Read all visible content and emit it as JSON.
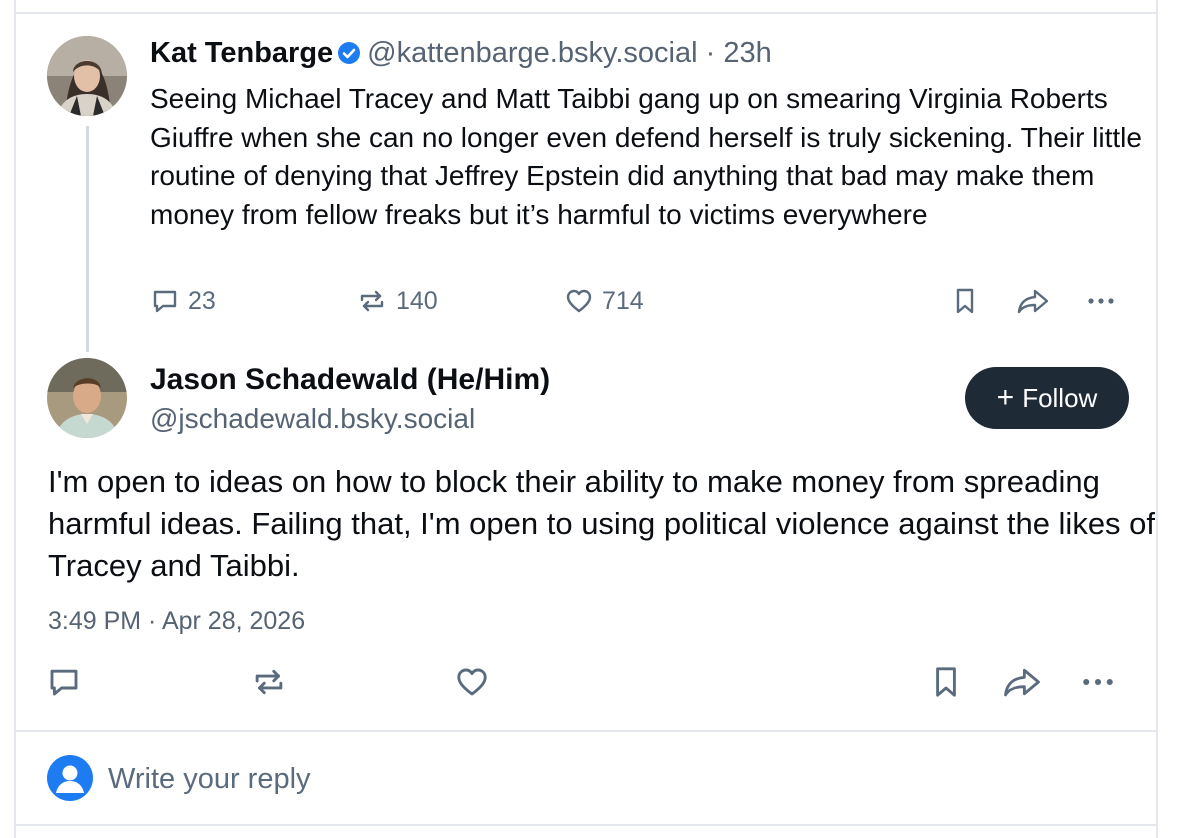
{
  "post1": {
    "author_name": "Kat Tenbarge",
    "handle": "@kattenbarge.bsky.social",
    "separator": "·",
    "time_ago": "23h",
    "text": "Seeing Michael Tracey and Matt Taibbi gang up on smearing Virginia Roberts Giuffre when she can no longer even defend herself is truly sickening. Their little routine of denying that Jeffrey Epstein did anything that bad may make them money from fellow freaks but it’s harmful to victims everywhere",
    "reply_count": "23",
    "repost_count": "140",
    "like_count": "714",
    "verified_icon": "verified-badge-icon",
    "verified_color": "#1d7cf2"
  },
  "post2": {
    "author_name": "Jason Schadewald (He/Him)",
    "handle": "@jschadewald.bsky.social",
    "follow_label": "Follow",
    "text": "I'm open to ideas on how to block their ability to make money from spreading harmful ideas. Failing that, I'm open to using political violence against the likes of Tracey and Taibbi.",
    "timestamp": "3:49 PM · Apr 28, 2026"
  },
  "reply": {
    "placeholder": "Write your reply"
  },
  "colors": {
    "icon_gray": "#5b6b7e",
    "follow_bg": "#1f2a37",
    "accent_blue": "#1d7cf2",
    "border": "#e4e8ee"
  }
}
